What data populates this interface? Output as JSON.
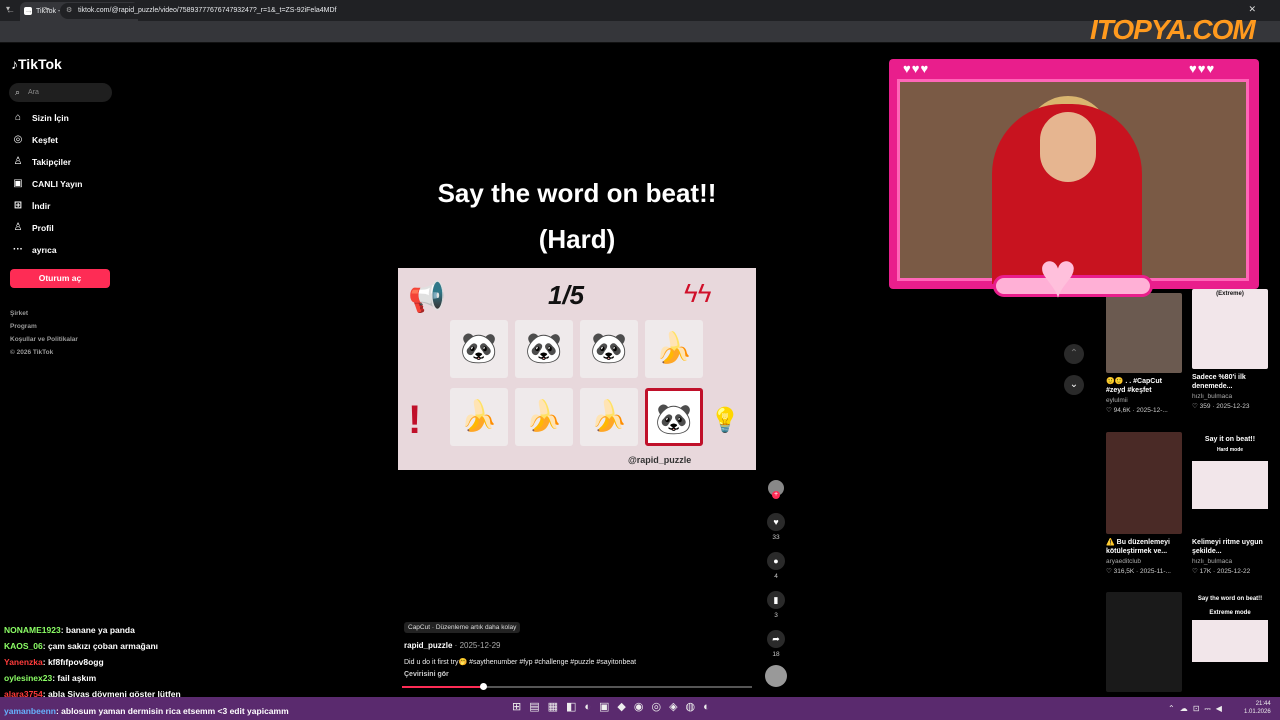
{
  "browser": {
    "tab_title": "TikTok - Gününüzü Güzelle...",
    "new_tab": "+",
    "url": "tiktok.com/@rapid_puzzle/video/7589377767674793247?_r=1&_t=ZS-92iFela4MDf"
  },
  "sidebar": {
    "logo": "TikTok",
    "search_placeholder": "Ara",
    "items": [
      {
        "label": "Sizin İçin",
        "icon": "home-icon",
        "glyph": "⌂"
      },
      {
        "label": "Keşfet",
        "icon": "compass-icon",
        "glyph": "◎"
      },
      {
        "label": "Takipçiler",
        "icon": "people-icon",
        "glyph": "♙"
      },
      {
        "label": "CANLI Yayın",
        "icon": "live-icon",
        "glyph": "▣"
      },
      {
        "label": "İndir",
        "icon": "download-icon",
        "glyph": "⊞"
      },
      {
        "label": "Profil",
        "icon": "profile-icon",
        "glyph": "♙"
      },
      {
        "label": "ayrıca",
        "icon": "more-icon",
        "glyph": "···"
      }
    ],
    "login": "Oturum aç",
    "footer": [
      "Şirket",
      "Program",
      "Koşullar ve Politikalar",
      "© 2026 TikTok"
    ]
  },
  "video": {
    "title_line1": "Say the word on beat!!",
    "title_line2": "(Hard)",
    "round": "1/5",
    "watermark": "@rapid_puzzle",
    "cells": [
      "🐼",
      "🐼",
      "🐼",
      "🍌",
      "🍌",
      "🍌",
      "🍌",
      "🐼"
    ],
    "selected_index": 7,
    "progress": 0.23
  },
  "actions": {
    "likes": "33",
    "comments": "4",
    "saves": "3",
    "shares": "18"
  },
  "meta": {
    "capcut": "CapCut · Düzenleme artık daha kolay",
    "author": "rapid_puzzle",
    "date": " · 2025-12-29",
    "description": "Did u do it first try🤭 #saythenumber #fyp #challenge #puzzle #sayitonbeat",
    "translate": "Çevirisini gör"
  },
  "related": [
    {
      "title": "🙂🙂 . . #CapCut #zeyd #keşfet",
      "user": "eylulmii",
      "stats": "♡ 94,6K · 2025-12-..."
    },
    {
      "title": "Sadece %80'i ilk denemede...",
      "user": "hızlı_bulmaca",
      "stats": "♡ 359 · 2025-12-23",
      "thumb_label": "(Extreme)"
    },
    {
      "title": "⚠️ Bu düzenlemeyi kötüleştirmek ve...",
      "user": "aryaeditclub",
      "stats": "♡ 316,5K · 2025-11-..."
    },
    {
      "title": "Kelimeyi ritme uygun şekilde...",
      "user": "hızlı_bulmaca",
      "stats": "♡ 17K · 2025-12-22",
      "thumb_label": "Say it on beat!!",
      "thumb_sub": "Hard mode"
    },
    {
      "thumb_label": "Say the word on beat!!",
      "thumb_sub": "Extreme mode"
    }
  ],
  "overlay": {
    "brand": "ITOPYA.COM",
    "hearts": "♥♥♥"
  },
  "chat": [
    {
      "user": "NONAME1923",
      "msg": ": banane ya panda",
      "color": "#8cff66"
    },
    {
      "user": "KAOS_06",
      "msg": ": çam sakızı çoban armağanı",
      "color": "#8cff66"
    },
    {
      "user": "Yanenzka",
      "msg": ": kf8fıfpov8ogg",
      "color": "#ff3b3b"
    },
    {
      "user": "oylesinex23",
      "msg": ": fail aşkım",
      "color": "#8cff66"
    },
    {
      "user": "alara3754",
      "msg": ": abla Sivas dövmeni göster lütfen",
      "color": "#ff3b3b"
    }
  ],
  "chat_bottom": {
    "user": "yamanbeenn",
    "msg": ": ablosum yaman dermisin rica etsemm <3 edit yapicamm",
    "color": "#66b3ff"
  },
  "clock": {
    "time": "21:44",
    "date": "1.01.2026"
  }
}
